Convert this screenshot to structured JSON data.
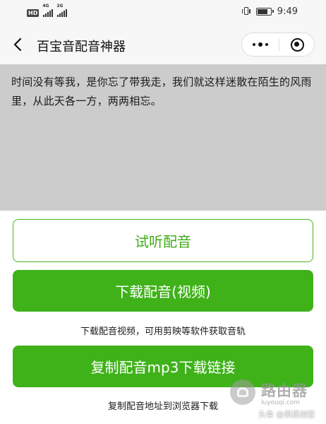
{
  "status_bar": {
    "hd_badge": "HD",
    "network_1": "4G",
    "network_2": "2G",
    "time": "9:49",
    "battery_level_percent": 80
  },
  "nav": {
    "title": "百宝音配音神器"
  },
  "text_area": {
    "content": "时间没有等我，是你忘了带我走，我们就这样迷散在陌生的风雨里，从此天各一方，两两相忘。"
  },
  "buttons": {
    "preview_label": "试听配音",
    "download_label": "下载配音(视频)",
    "download_hint": "下载配音视频，可用剪映等软件获取音轨",
    "copy_label": "复制配音mp3下载链接",
    "copy_hint": "复制配音地址到浏览器下载"
  },
  "watermark": {
    "brand": "路由器",
    "url": "luyouqi.com",
    "author": "头条 @黑狐创客"
  },
  "colors": {
    "accent_green": "#3fb21a",
    "text_area_bg": "#cccccc",
    "nav_bg": "#f7f7f7"
  },
  "icons": [
    "hd-icon",
    "signal-icon",
    "vibrate-icon",
    "battery-icon",
    "back-icon",
    "more-icon",
    "close-target-icon",
    "watermark-logo-icon"
  ]
}
